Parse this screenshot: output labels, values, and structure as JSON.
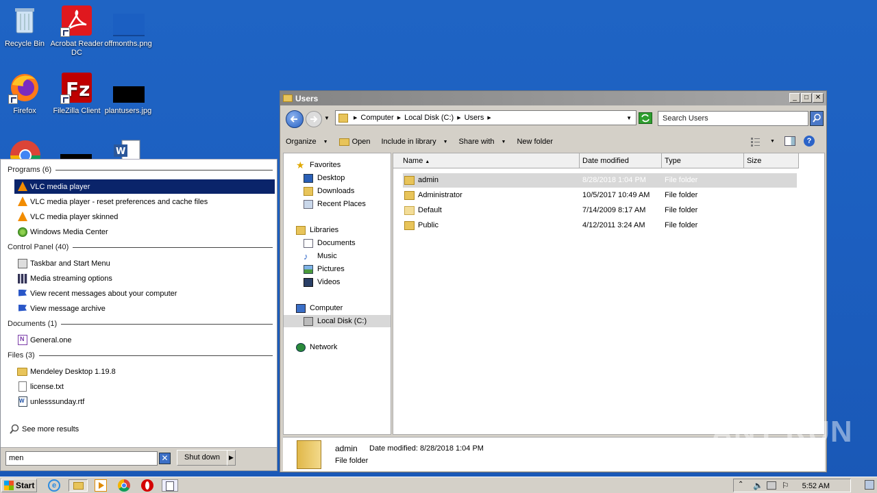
{
  "desktop": {
    "icons": [
      {
        "label": "Recycle Bin"
      },
      {
        "label": "Acrobat Reader DC"
      },
      {
        "label": "offmonths.png"
      },
      {
        "label": "Firefox"
      },
      {
        "label": "FileZilla Client"
      },
      {
        "label": "plantusers.jpg"
      }
    ]
  },
  "start_menu": {
    "sections": [
      {
        "label": "Programs (6)"
      },
      {
        "label": "Control Panel (40)"
      },
      {
        "label": "Documents (1)"
      },
      {
        "label": "Files (3)"
      }
    ],
    "programs": [
      "VLC media player",
      "VLC media player - reset preferences and cache files",
      "VLC media player skinned",
      "Windows Media Center"
    ],
    "control_panel": [
      "Taskbar and Start Menu",
      "Media streaming options",
      "View recent messages about your computer",
      "View message archive"
    ],
    "documents": [
      "General.one"
    ],
    "files": [
      "Mendeley Desktop 1.19.8",
      "license.txt",
      "unlesssunday.rtf"
    ],
    "see_more": "See more results",
    "search_value": "men",
    "shutdown_label": "Shut down"
  },
  "explorer": {
    "title": "Users",
    "breadcrumb": [
      "Computer",
      "Local Disk (C:)",
      "Users"
    ],
    "search_placeholder": "Search Users",
    "toolbar": {
      "organize": "Organize",
      "open": "Open",
      "include": "Include in library",
      "share": "Share with",
      "new_folder": "New folder"
    },
    "nav": {
      "favorites": "Favorites",
      "desktop": "Desktop",
      "downloads": "Downloads",
      "recent": "Recent Places",
      "libraries": "Libraries",
      "documents": "Documents",
      "music": "Music",
      "pictures": "Pictures",
      "videos": "Videos",
      "computer": "Computer",
      "local_disk": "Local Disk (C:)",
      "network": "Network"
    },
    "columns": {
      "name": "Name",
      "date": "Date modified",
      "type": "Type",
      "size": "Size"
    },
    "rows": [
      {
        "name": "admin",
        "date": "8/28/2018 1:04 PM",
        "type": "File folder"
      },
      {
        "name": "Administrator",
        "date": "10/5/2017 10:49 AM",
        "type": "File folder"
      },
      {
        "name": "Default",
        "date": "7/14/2009 8:17 AM",
        "type": "File folder"
      },
      {
        "name": "Public",
        "date": "4/12/2011 3:24 AM",
        "type": "File folder"
      }
    ],
    "details": {
      "name": "admin",
      "date_label": "Date modified:",
      "date": "8/28/2018 1:04 PM",
      "type": "File folder"
    }
  },
  "taskbar": {
    "start": "Start",
    "clock": "5:52 AM"
  },
  "watermark": "ANY RUN"
}
